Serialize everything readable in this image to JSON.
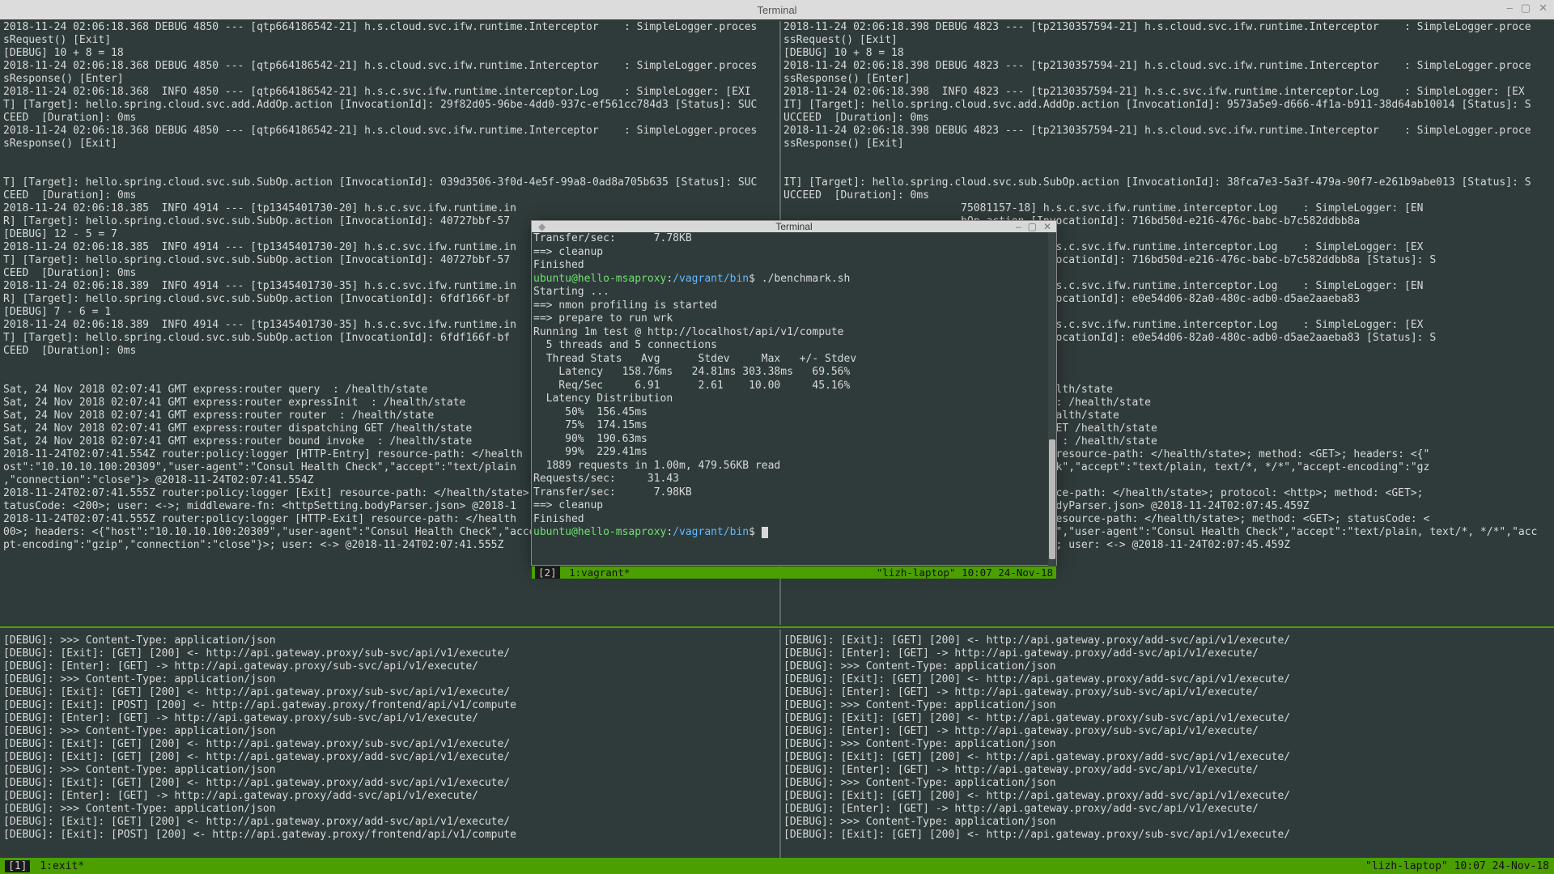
{
  "outer_window": {
    "title": "Terminal",
    "minimize": "–",
    "maximize": "▢",
    "close": "✕"
  },
  "float_window": {
    "title": "Terminal",
    "dot": "◆",
    "minimize": "–",
    "maximize": "▢",
    "close": "✕"
  },
  "outer_status": {
    "left_win": "[1]",
    "left_name": "1:exit*",
    "right": "\"lizh-laptop\" 10:07 24-Nov-18"
  },
  "float_status": {
    "left_win": "[2]",
    "left_name": "1:vagrant*",
    "right": "\"lizh-laptop\" 10:07 24-Nov-18"
  },
  "pane_tl": "2018-11-24 02:06:18.368 DEBUG 4850 --- [qtp664186542-21] h.s.cloud.svc.ifw.runtime.Interceptor    : SimpleLogger.proces\nsRequest() [Exit]\n[DEBUG] 10 + 8 = 18\n2018-11-24 02:06:18.368 DEBUG 4850 --- [qtp664186542-21] h.s.cloud.svc.ifw.runtime.Interceptor    : SimpleLogger.proces\nsResponse() [Enter]\n2018-11-24 02:06:18.368  INFO 4850 --- [qtp664186542-21] h.s.c.svc.ifw.runtime.interceptor.Log    : SimpleLogger: [EXI\nT] [Target]: hello.spring.cloud.svc.add.AddOp.action [InvocationId]: 29f82d05-96be-4dd0-937c-ef561cc784d3 [Status]: SUC\nCEED  [Duration]: 0ms\n2018-11-24 02:06:18.368 DEBUG 4850 --- [qtp664186542-21] h.s.cloud.svc.ifw.runtime.Interceptor    : SimpleLogger.proces\nsResponse() [Exit]\n\n\nT] [Target]: hello.spring.cloud.svc.sub.SubOp.action [InvocationId]: 039d3506-3f0d-4e5f-99a8-0ad8a705b635 [Status]: SUC\nCEED  [Duration]: 0ms\n2018-11-24 02:06:18.385  INFO 4914 --- [tp1345401730-20] h.s.c.svc.ifw.runtime.in\nR] [Target]: hello.spring.cloud.svc.sub.SubOp.action [InvocationId]: 40727bbf-57\n[DEBUG] 12 - 5 = 7\n2018-11-24 02:06:18.385  INFO 4914 --- [tp1345401730-20] h.s.c.svc.ifw.runtime.in\nT] [Target]: hello.spring.cloud.svc.sub.SubOp.action [InvocationId]: 40727bbf-57\nCEED  [Duration]: 0ms\n2018-11-24 02:06:18.389  INFO 4914 --- [tp1345401730-35] h.s.c.svc.ifw.runtime.in\nR] [Target]: hello.spring.cloud.svc.sub.SubOp.action [InvocationId]: 6fdf166f-bf\n[DEBUG] 7 - 6 = 1\n2018-11-24 02:06:18.389  INFO 4914 --- [tp1345401730-35] h.s.c.svc.ifw.runtime.in\nT] [Target]: hello.spring.cloud.svc.sub.SubOp.action [InvocationId]: 6fdf166f-bf\nCEED  [Duration]: 0ms\n\n\nSat, 24 Nov 2018 02:07:41 GMT express:router query  : /health/state\nSat, 24 Nov 2018 02:07:41 GMT express:router expressInit  : /health/state\nSat, 24 Nov 2018 02:07:41 GMT express:router router  : /health/state\nSat, 24 Nov 2018 02:07:41 GMT express:router dispatching GET /health/state\nSat, 24 Nov 2018 02:07:41 GMT express:router bound invoke  : /health/state\n2018-11-24T02:07:41.554Z router:policy:logger [HTTP-Entry] resource-path: </health\nost\":\"10.10.10.100:20309\",\"user-agent\":\"Consul Health Check\",\"accept\":\"text/plain\n,\"connection\":\"close\"}> @2018-11-24T02:07:41.554Z\n2018-11-24T02:07:41.555Z router:policy:logger [Exit] resource-path: </health/state>; protocol: <http>; method: <GET>; s\ntatusCode: <200>; user: <->; middleware-fn: <httpSetting.bodyParser.json> @2018-1\n2018-11-24T02:07:41.555Z router:policy:logger [HTTP-Exit] resource-path: </health\n00>; headers: <{\"host\":\"10.10.10.100:20309\",\"user-agent\":\"Consul Health Check\",\"accept\":\"text/plain, text/*, */*\",\"acce\npt-encoding\":\"gzip\",\"connection\":\"close\"}>; user: <-> @2018-11-24T02:07:41.555Z",
  "pane_tr": "2018-11-24 02:06:18.398 DEBUG 4823 --- [tp2130357594-21] h.s.cloud.svc.ifw.runtime.Interceptor    : SimpleLogger.proce\nssRequest() [Exit]\n[DEBUG] 10 + 8 = 18\n2018-11-24 02:06:18.398 DEBUG 4823 --- [tp2130357594-21] h.s.cloud.svc.ifw.runtime.Interceptor    : SimpleLogger.proce\nssResponse() [Enter]\n2018-11-24 02:06:18.398  INFO 4823 --- [tp2130357594-21] h.s.c.svc.ifw.runtime.interceptor.Log    : SimpleLogger: [EX\nIT] [Target]: hello.spring.cloud.svc.add.AddOp.action [InvocationId]: 9573a5e9-d666-4f1a-b911-38d64ab10014 [Status]: S\nUCCEED  [Duration]: 0ms\n2018-11-24 02:06:18.398 DEBUG 4823 --- [tp2130357594-21] h.s.cloud.svc.ifw.runtime.Interceptor    : SimpleLogger.proce\nssResponse() [Exit]\n\n\nIT] [Target]: hello.spring.cloud.svc.sub.SubOp.action [InvocationId]: 38fca7e3-5a3f-479a-90f7-e261b9abe013 [Status]: S\nUCCEED  [Duration]: 0ms\n                            75081157-18] h.s.c.svc.ifw.runtime.interceptor.Log    : SimpleLogger: [EN\n                            bOp.action [InvocationId]: 716bd50d-e216-476c-babc-b7c582ddbb8a\n\n                            75081157-18] h.s.c.svc.ifw.runtime.interceptor.Log    : SimpleLogger: [EX\n                            bOp.action [InvocationId]: 716bd50d-e216-476c-babc-b7c582ddbb8a [Status]: S\n\n                            75081157-17] h.s.c.svc.ifw.runtime.interceptor.Log    : SimpleLogger: [EN\n                            bOp.action [InvocationId]: e0e54d06-82a0-480c-adb0-d5ae2aaeba83\n\n                            75081157-17] h.s.c.svc.ifw.runtime.interceptor.Log    : SimpleLogger: [EX\n                            bOp.action [InvocationId]: e0e54d06-82a0-480c-adb0-d5ae2aaeba83 [Status]: S\n\n\n\n                            r query  : /health/state\n                            r expressInit  : /health/state\n                            r router  : /health/state\n                            r dispatching GET /health/state\n                            r bound invoke  : /health/state\n                            r [HTTP-Entry] resource-path: </health/state>; method: <GET>; headers: <{\"\n                            sul Health Check\",\"accept\":\"text/plain, text/*, */*\",\"accept-encoding\":\"gz\n                            :45.459Z\n                            r [Exit] resource-path: </health/state>; protocol: <http>; method: <GET>;\n                            <httpSetting.bodyParser.json> @2018-11-24T02:07:45.459Z\n                            r [HTTP-Exit] resource-path: </health/state>; method: <GET>; statusCode: <\n200>; headers: <{\"host\":\"10.10.10.100:25502\",\"user-agent\":\"Consul Health Check\",\"accept\":\"text/plain, text/*, */*\",\"acc\nept-encoding\":\"gzip\",\"connection\":\"close\"}>; user: <-> @2018-11-24T02:07:45.459Z",
  "pane_bl": "[DEBUG]: >>> Content-Type: application/json\n[DEBUG]: [Exit]: [GET] [200] <- http://api.gateway.proxy/sub-svc/api/v1/execute/\n[DEBUG]: [Enter]: [GET] -> http://api.gateway.proxy/sub-svc/api/v1/execute/\n[DEBUG]: >>> Content-Type: application/json\n[DEBUG]: [Exit]: [GET] [200] <- http://api.gateway.proxy/sub-svc/api/v1/execute/\n[DEBUG]: [Exit]: [POST] [200] <- http://api.gateway.proxy/frontend/api/v1/compute\n[DEBUG]: [Enter]: [GET] -> http://api.gateway.proxy/sub-svc/api/v1/execute/\n[DEBUG]: >>> Content-Type: application/json\n[DEBUG]: [Exit]: [GET] [200] <- http://api.gateway.proxy/sub-svc/api/v1/execute/\n[DEBUG]: [Exit]: [GET] [200] <- http://api.gateway.proxy/add-svc/api/v1/execute/\n[DEBUG]: >>> Content-Type: application/json\n[DEBUG]: [Exit]: [GET] [200] <- http://api.gateway.proxy/add-svc/api/v1/execute/\n[DEBUG]: [Enter]: [GET] -> http://api.gateway.proxy/add-svc/api/v1/execute/\n[DEBUG]: >>> Content-Type: application/json\n[DEBUG]: [Exit]: [GET] [200] <- http://api.gateway.proxy/add-svc/api/v1/execute/\n[DEBUG]: [Exit]: [POST] [200] <- http://api.gateway.proxy/frontend/api/v1/compute",
  "pane_br": "[DEBUG]: [Exit]: [GET] [200] <- http://api.gateway.proxy/add-svc/api/v1/execute/\n[DEBUG]: [Enter]: [GET] -> http://api.gateway.proxy/add-svc/api/v1/execute/\n[DEBUG]: >>> Content-Type: application/json\n[DEBUG]: [Exit]: [GET] [200] <- http://api.gateway.proxy/add-svc/api/v1/execute/\n[DEBUG]: [Enter]: [GET] -> http://api.gateway.proxy/sub-svc/api/v1/execute/\n[DEBUG]: >>> Content-Type: application/json\n[DEBUG]: [Exit]: [GET] [200] <- http://api.gateway.proxy/sub-svc/api/v1/execute/\n[DEBUG]: [Enter]: [GET] -> http://api.gateway.proxy/sub-svc/api/v1/execute/\n[DEBUG]: >>> Content-Type: application/json\n[DEBUG]: [Exit]: [GET] [200] <- http://api.gateway.proxy/add-svc/api/v1/execute/\n[DEBUG]: [Enter]: [GET] -> http://api.gateway.proxy/add-svc/api/v1/execute/\n[DEBUG]: >>> Content-Type: application/json\n[DEBUG]: [Exit]: [GET] [200] <- http://api.gateway.proxy/add-svc/api/v1/execute/\n[DEBUG]: [Enter]: [GET] -> http://api.gateway.proxy/add-svc/api/v1/execute/\n[DEBUG]: >>> Content-Type: application/json\n[DEBUG]: [Exit]: [GET] [200] <- http://api.gateway.proxy/sub-svc/api/v1/execute/",
  "float_pre": "Transfer/sec:      7.78KB\n==> cleanup\nFinished",
  "float_cmd": "./benchmark.sh",
  "float_out": "Starting ...\n==> nmon profiling is started\n==> prepare to run wrk\nRunning 1m test @ http://localhost/api/v1/compute\n  5 threads and 5 connections\n  Thread Stats   Avg      Stdev     Max   +/- Stdev\n    Latency   158.76ms   24.81ms 303.38ms   69.56%\n    Req/Sec     6.91      2.61    10.00     45.16%\n  Latency Distribution\n     50%  156.45ms\n     75%  174.15ms\n     90%  190.63ms\n     99%  229.41ms\n  1889 requests in 1.00m, 479.56KB read\nRequests/sec:     31.43\nTransfer/sec:      7.98KB\n==> cleanup\nFinished",
  "prompt": {
    "user": "ubuntu@hello-msaproxy",
    "sep": ":",
    "path": "/vagrant/bin",
    "dollar": "$ "
  }
}
